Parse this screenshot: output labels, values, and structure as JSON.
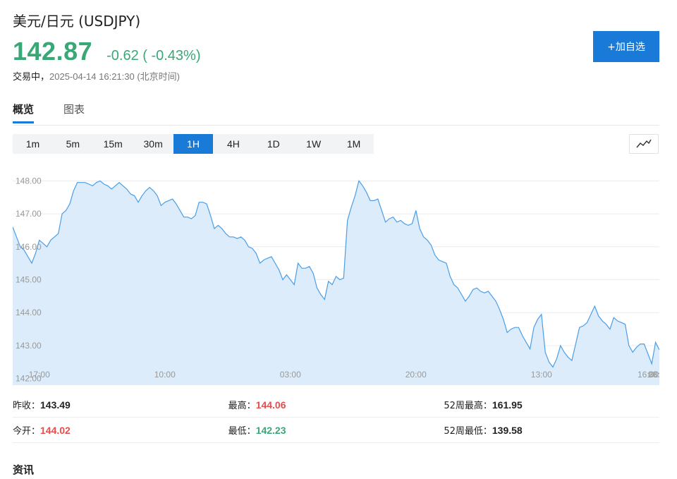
{
  "header": {
    "title": "美元/日元  (USDJPY)",
    "price": "142.87",
    "change": "-0.62 ( -0.43%)",
    "status": "交易中，",
    "timestamp": "2025-04-14 16:21:30 (北京时间)",
    "add_button": "+加自选"
  },
  "tabs": [
    {
      "label": "概览",
      "active": true
    },
    {
      "label": "图表",
      "active": false
    }
  ],
  "intervals": [
    {
      "label": "1m",
      "active": false
    },
    {
      "label": "5m",
      "active": false
    },
    {
      "label": "15m",
      "active": false
    },
    {
      "label": "30m",
      "active": false
    },
    {
      "label": "1H",
      "active": true
    },
    {
      "label": "4H",
      "active": false
    },
    {
      "label": "1D",
      "active": false
    },
    {
      "label": "1W",
      "active": false
    },
    {
      "label": "1M",
      "active": false
    }
  ],
  "chart_type_icon": "line-chart-icon",
  "colors": {
    "up": "#e84c4c",
    "down": "#3aa776",
    "accent": "#1a7ad8",
    "line": "#4a9ee8",
    "area": "#dcecfb"
  },
  "chart_data": {
    "type": "area",
    "ylim": [
      141.8,
      148.5
    ],
    "yticks": [
      "148.00",
      "147.00",
      "146.00",
      "145.00",
      "144.00",
      "143.00",
      "142.00"
    ],
    "yticks_values": [
      148,
      147,
      146,
      145,
      144,
      143,
      142
    ],
    "xticks": [
      "17:00",
      "10:00",
      "03:00",
      "20:00",
      "13:00",
      "06:00",
      "23:00",
      "16:00"
    ],
    "xticks_index": [
      7,
      40,
      73,
      106,
      139,
      172,
      205,
      238
    ],
    "grid": true,
    "values": [
      146.6,
      146.3,
      146.0,
      145.9,
      145.7,
      145.5,
      145.8,
      146.2,
      146.1,
      146.0,
      146.2,
      146.3,
      146.4,
      147.0,
      147.1,
      147.3,
      147.7,
      147.95,
      147.95,
      147.95,
      147.9,
      147.85,
      147.95,
      148.0,
      147.9,
      147.85,
      147.75,
      147.85,
      147.95,
      147.85,
      147.75,
      147.6,
      147.55,
      147.35,
      147.55,
      147.7,
      147.8,
      147.7,
      147.55,
      147.25,
      147.35,
      147.4,
      147.45,
      147.3,
      147.1,
      146.9,
      146.9,
      146.85,
      146.95,
      147.35,
      147.35,
      147.3,
      146.95,
      146.55,
      146.65,
      146.55,
      146.4,
      146.3,
      146.3,
      146.25,
      146.3,
      146.2,
      146.0,
      145.95,
      145.8,
      145.5,
      145.6,
      145.65,
      145.7,
      145.5,
      145.3,
      145.0,
      145.15,
      145.0,
      144.85,
      145.5,
      145.35,
      145.35,
      145.4,
      145.2,
      144.75,
      144.55,
      144.4,
      144.95,
      144.85,
      145.1,
      145.0,
      145.05,
      146.8,
      147.2,
      147.55,
      148.0,
      147.85,
      147.65,
      147.4,
      147.4,
      147.45,
      147.1,
      146.75,
      146.85,
      146.9,
      146.75,
      146.8,
      146.7,
      146.65,
      146.7,
      147.1,
      146.55,
      146.3,
      146.2,
      146.05,
      145.75,
      145.6,
      145.55,
      145.5,
      145.1,
      144.85,
      144.75,
      144.55,
      144.35,
      144.5,
      144.7,
      144.75,
      144.65,
      144.6,
      144.65,
      144.5,
      144.35,
      144.1,
      143.8,
      143.4,
      143.5,
      143.55,
      143.55,
      143.3,
      143.1,
      142.9,
      143.55,
      143.8,
      143.95,
      142.8,
      142.5,
      142.35,
      142.6,
      143.0,
      142.8,
      142.65,
      142.55,
      143.05,
      143.55,
      143.6,
      143.7,
      143.95,
      144.2,
      143.9,
      143.75,
      143.65,
      143.5,
      143.85,
      143.75,
      143.7,
      143.65,
      143.0,
      142.8,
      142.95,
      143.05,
      143.05,
      142.75,
      142.45,
      143.1,
      142.87
    ]
  },
  "stats": [
    [
      {
        "label": "昨收：",
        "value": "143.49",
        "tone": "neutral"
      },
      {
        "label": "最高：",
        "value": "144.06",
        "tone": "up"
      },
      {
        "label": "52周最高：",
        "value": "161.95",
        "tone": "neutral"
      }
    ],
    [
      {
        "label": "今开：",
        "value": "144.02",
        "tone": "up"
      },
      {
        "label": "最低：",
        "value": "142.23",
        "tone": "down"
      },
      {
        "label": "52周最低：",
        "value": "139.58",
        "tone": "neutral"
      }
    ]
  ],
  "news": {
    "title": "资讯"
  }
}
